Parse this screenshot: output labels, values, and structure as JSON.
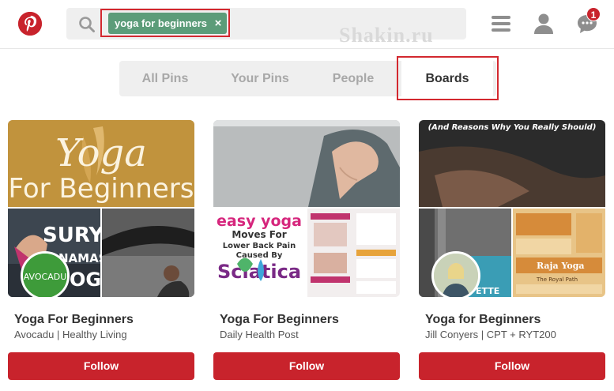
{
  "header": {
    "logo_icon": "pinterest-logo",
    "search": {
      "icon": "search-icon",
      "tag_label": "yoga for beginners",
      "tag_close": "×"
    },
    "watermark": "Shakin.ru",
    "icons": [
      "menu-icon",
      "profile-icon",
      "chat-icon"
    ],
    "notification_count": "1",
    "accent_color": "#c8232c"
  },
  "tabs": [
    {
      "label": "All Pins",
      "active": false
    },
    {
      "label": "Your Pins",
      "active": false
    },
    {
      "label": "People",
      "active": false
    },
    {
      "label": "Boards",
      "active": true
    }
  ],
  "boards": [
    {
      "cover_text_1": "Yoga",
      "cover_text_2": "For Beginners",
      "collage_text": "SURY\nNAMAS\nOG",
      "avatar_text": "AVOCADU",
      "title": "Yoga For Beginners",
      "subtitle": "Avocadu | Healthy Living",
      "follow_label": "Follow"
    },
    {
      "cover_text_1": "",
      "cover_text_2": "",
      "collage_text_1": "easy yoga",
      "collage_text_2": "Moves For",
      "collage_text_3": "Lower Back Pain",
      "collage_text_4": "Caused By",
      "collage_text_5": "Sciatica",
      "title": "Yoga For Beginners",
      "subtitle": "Daily Health Post",
      "follow_label": "Follow"
    },
    {
      "cover_text_1": "(And Reasons Why You Really Should)",
      "collage_text": "Raja Yoga",
      "collage_text_2": "The Royal Path",
      "collage_text_3": "ETTE",
      "title": "Yoga for Beginners",
      "subtitle": "Jill Conyers | CPT + RYT200",
      "follow_label": "Follow"
    }
  ]
}
